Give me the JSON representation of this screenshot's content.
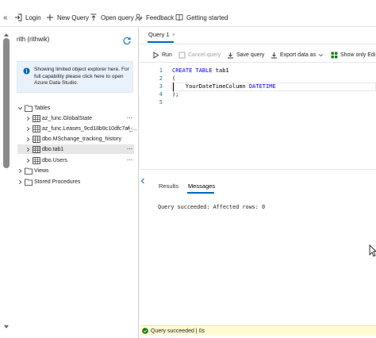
{
  "toolbar": {
    "collapse_label": "«",
    "login": "Login",
    "new_query": "New Query",
    "open_query": "Open query",
    "feedback": "Feedback",
    "getting_started": "Getting started"
  },
  "explorer": {
    "connection_title": "rith (rithwik)",
    "notice": "Showing limited object explorer here. For full capability please click here to open Azure Data Studio.",
    "tables_label": "Tables",
    "tables": [
      {
        "name": "az_func.GlobalState"
      },
      {
        "name": "az_func.Leases_9cd18b9c10dfc7af_..."
      },
      {
        "name": "dbo.MSchange_tracking_history"
      },
      {
        "name": "dbo.tab1"
      },
      {
        "name": "dbo.Users"
      }
    ],
    "views_label": "Views",
    "procs_label": "Stored Procedures",
    "more": "···"
  },
  "query_tab": {
    "label": "Query 1",
    "close": "×"
  },
  "query_toolbar": {
    "run": "Run",
    "cancel": "Cancel query",
    "save": "Save query",
    "export": "Export data as",
    "show_only": "Show only Edi"
  },
  "editor": {
    "line_numbers": [
      "1",
      "2",
      "3",
      "4",
      "5"
    ],
    "lines": {
      "l1_kw": "CREATE TABLE",
      "l1_rest": " tab1",
      "l2": "(",
      "l3_name": "    YourDateTimeColumn ",
      "l3_type": "DATETIME",
      "l4": ");",
      "l5": ""
    }
  },
  "results": {
    "tab_results": "Results",
    "tab_messages": "Messages",
    "message": "Query succeeded: Affected rows: 0"
  },
  "status": {
    "text": "Query succeeded | 0s",
    "color": "#107c10"
  },
  "colors": {
    "accent": "#0067b8",
    "keyword": "#0000ff",
    "line_number": "#237893",
    "info_bg": "#e9f2fb",
    "status_bg": "#fffbd6"
  }
}
